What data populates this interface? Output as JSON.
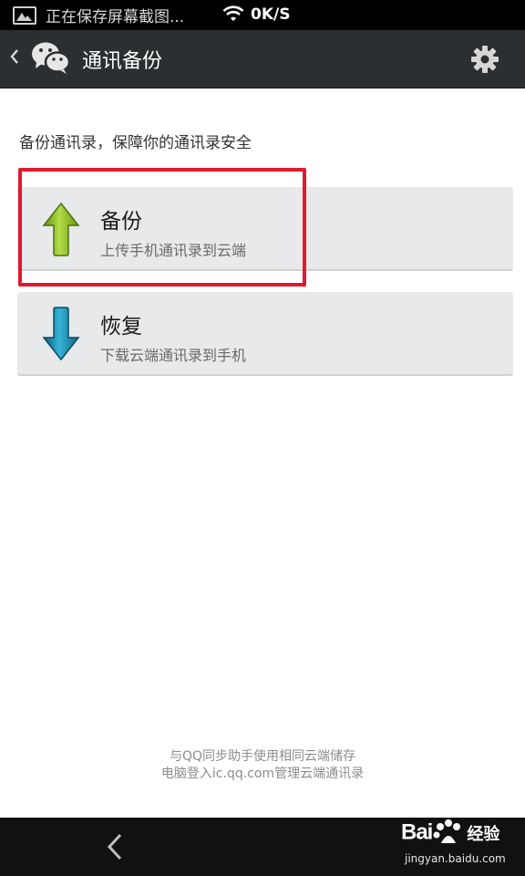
{
  "status_bar": {
    "saving_text": "正在保存屏幕截图...",
    "speed": "0K/S"
  },
  "action_bar": {
    "title": "通讯备份"
  },
  "main": {
    "description": "备份通讯录，保障你的通讯录安全",
    "backup": {
      "title": "备份",
      "subtitle": "上传手机通讯录到云端"
    },
    "restore": {
      "title": "恢复",
      "subtitle": "下载云端通讯录到手机"
    }
  },
  "footer": {
    "line1": "与QQ同步助手使用相同云端储存",
    "line2": "电脑登入ic.qq.com管理云端通讯录"
  },
  "watermark": {
    "brand": "Bai",
    "brand2": "经验",
    "url": "jingyan.baidu.com"
  },
  "colors": {
    "highlight": "#e0192e",
    "action_bar": "#2b2f31",
    "backup_arrow": "#7fb51c",
    "restore_arrow": "#1c86a8"
  }
}
